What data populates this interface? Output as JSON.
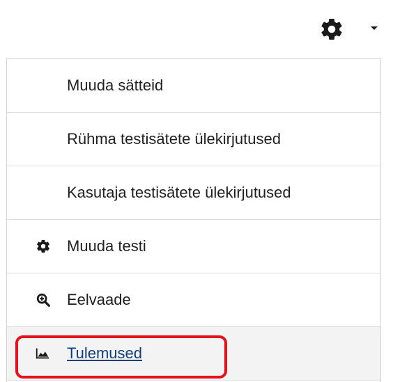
{
  "toolbar": {
    "settings_icon": "gear-icon",
    "dropdown_icon": "caret-down-icon"
  },
  "menu": {
    "items": [
      {
        "label": "Muuda sätteid",
        "icon": null,
        "active": false
      },
      {
        "label": "Rühma testisätete ülekirjutused",
        "icon": null,
        "active": false
      },
      {
        "label": "Kasutaja testisätete ülekirjutused",
        "icon": null,
        "active": false
      },
      {
        "label": "Muuda testi",
        "icon": "gear-icon",
        "active": false
      },
      {
        "label": "Eelvaade",
        "icon": "zoom-in-icon",
        "active": false
      },
      {
        "label": "Tulemused",
        "icon": "area-chart-icon",
        "active": true
      }
    ]
  },
  "colors": {
    "highlight": "#e8101a",
    "link": "#0f3f7a",
    "active_bg": "#f3f3f3"
  }
}
